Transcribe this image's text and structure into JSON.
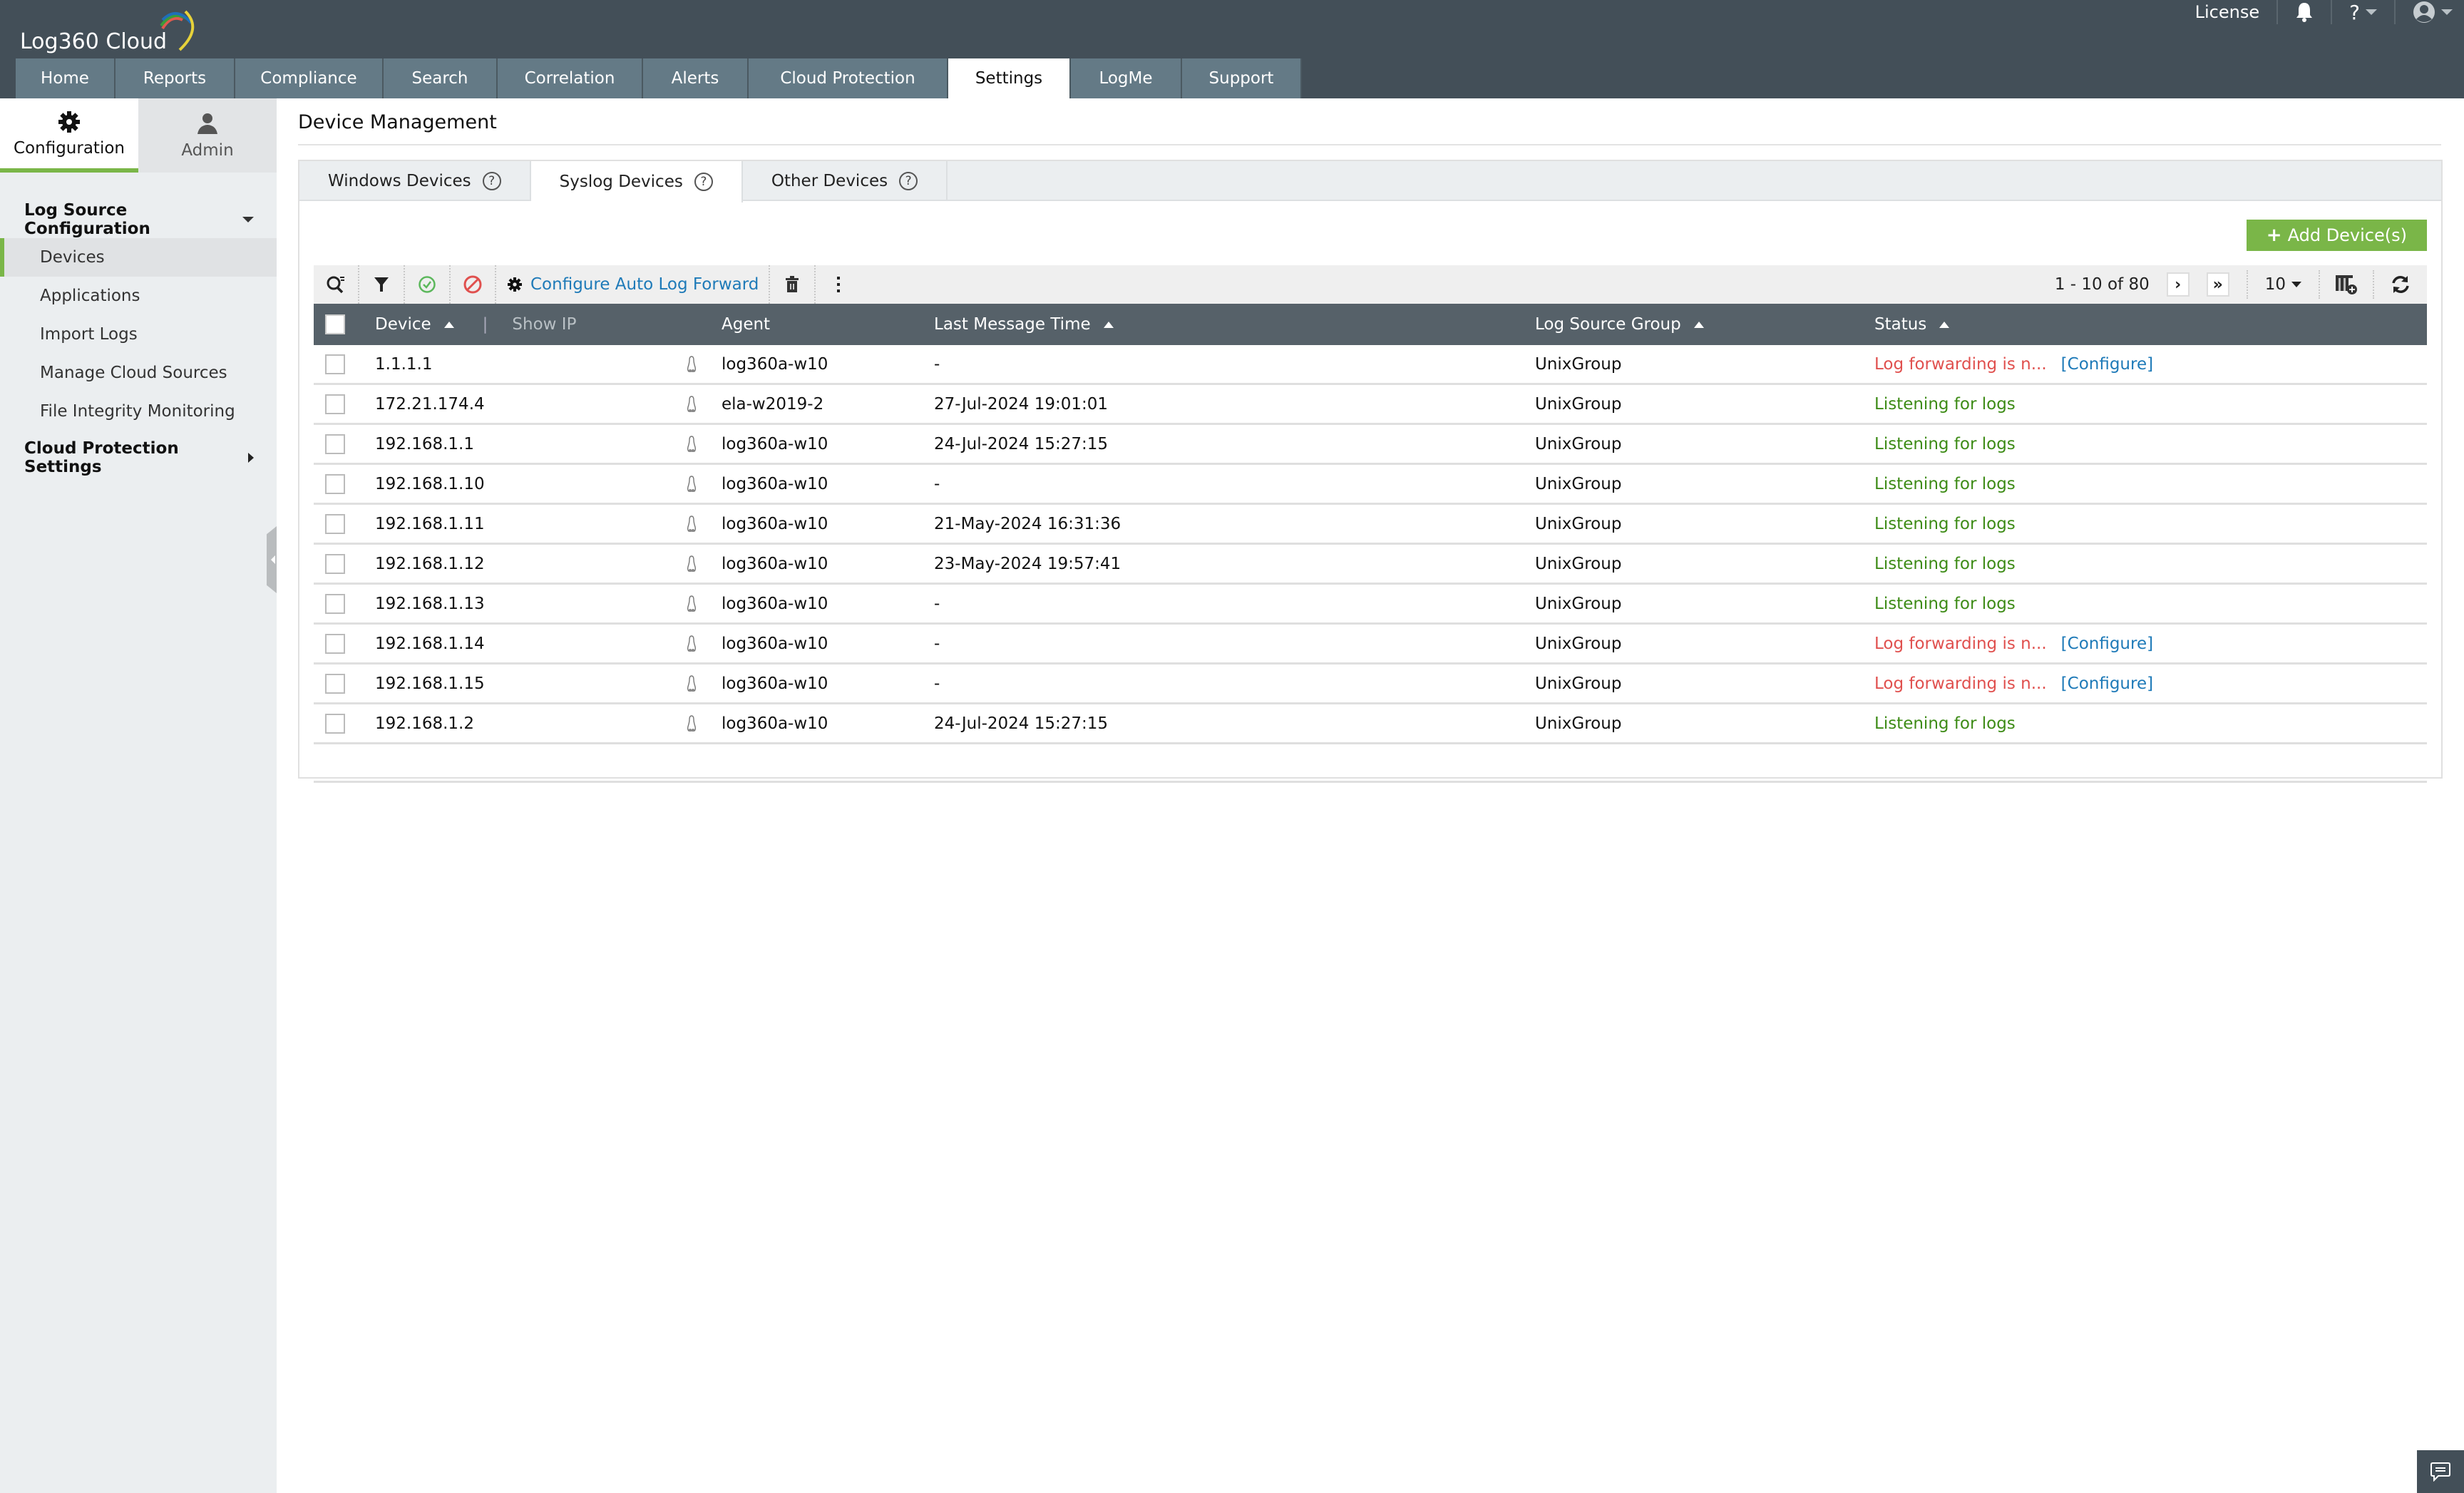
{
  "app": {
    "logo_text": "Log360 Cloud",
    "brand_accent": "#7ab648"
  },
  "header": {
    "license_label": "License",
    "help_label": "?",
    "icons": [
      "bell-icon",
      "help-icon",
      "user-avatar-icon"
    ]
  },
  "nav": {
    "tabs": [
      {
        "label": "Home"
      },
      {
        "label": "Reports"
      },
      {
        "label": "Compliance"
      },
      {
        "label": "Search"
      },
      {
        "label": "Correlation"
      },
      {
        "label": "Alerts"
      },
      {
        "label": "Cloud Protection"
      },
      {
        "label": "Settings",
        "active": true
      },
      {
        "label": "LogMe"
      },
      {
        "label": "Support"
      }
    ]
  },
  "sidebar": {
    "switch": [
      {
        "label": "Configuration",
        "icon": "gear-icon",
        "active": true
      },
      {
        "label": "Admin",
        "icon": "admin-user-icon"
      }
    ],
    "group1": {
      "label": "Log Source Configuration",
      "expanded": true,
      "items": [
        {
          "label": "Devices",
          "active": true
        },
        {
          "label": "Applications"
        },
        {
          "label": "Import Logs"
        },
        {
          "label": "Manage Cloud Sources"
        },
        {
          "label": "File Integrity Monitoring"
        }
      ]
    },
    "group2": {
      "label": "Cloud Protection Settings",
      "expanded": false
    }
  },
  "main": {
    "title": "Device Management",
    "tabs": [
      {
        "label": "Windows Devices"
      },
      {
        "label": "Syslog Devices",
        "active": true
      },
      {
        "label": "Other Devices"
      }
    ],
    "add_button": "Add Device(s)",
    "toolbar": {
      "configure_link": "Configure Auto Log Forward",
      "pagination_text": "1 - 10 of 80",
      "page_size": "10"
    },
    "table": {
      "headers": {
        "device": "Device",
        "show_ip": "Show IP",
        "agent": "Agent",
        "last_message_time": "Last Message Time",
        "log_source_group": "Log Source Group",
        "status": "Status"
      },
      "configure_label": "[Configure]",
      "rows": [
        {
          "device": "1.1.1.1",
          "agent": "log360a-w10",
          "time": "-",
          "group": "UnixGroup",
          "status": "Log forwarding is n...",
          "status_type": "error",
          "configure": true
        },
        {
          "device": "172.21.174.4",
          "agent": "ela-w2019-2",
          "time": "27-Jul-2024 19:01:01",
          "group": "UnixGroup",
          "status": "Listening for logs",
          "status_type": "ok",
          "configure": false
        },
        {
          "device": "192.168.1.1",
          "agent": "log360a-w10",
          "time": "24-Jul-2024 15:27:15",
          "group": "UnixGroup",
          "status": "Listening for logs",
          "status_type": "ok",
          "configure": false
        },
        {
          "device": "192.168.1.10",
          "agent": "log360a-w10",
          "time": "-",
          "group": "UnixGroup",
          "status": "Listening for logs",
          "status_type": "ok",
          "configure": false
        },
        {
          "device": "192.168.1.11",
          "agent": "log360a-w10",
          "time": "21-May-2024 16:31:36",
          "group": "UnixGroup",
          "status": "Listening for logs",
          "status_type": "ok",
          "configure": false
        },
        {
          "device": "192.168.1.12",
          "agent": "log360a-w10",
          "time": "23-May-2024 19:57:41",
          "group": "UnixGroup",
          "status": "Listening for logs",
          "status_type": "ok",
          "configure": false
        },
        {
          "device": "192.168.1.13",
          "agent": "log360a-w10",
          "time": "-",
          "group": "UnixGroup",
          "status": "Listening for logs",
          "status_type": "ok",
          "configure": false
        },
        {
          "device": "192.168.1.14",
          "agent": "log360a-w10",
          "time": "-",
          "group": "UnixGroup",
          "status": "Log forwarding is n...",
          "status_type": "error",
          "configure": true
        },
        {
          "device": "192.168.1.15",
          "agent": "log360a-w10",
          "time": "-",
          "group": "UnixGroup",
          "status": "Log forwarding is n...",
          "status_type": "error",
          "configure": true
        },
        {
          "device": "192.168.1.2",
          "agent": "log360a-w10",
          "time": "24-Jul-2024 15:27:15",
          "group": "UnixGroup",
          "status": "Listening for logs",
          "status_type": "ok",
          "configure": false
        }
      ]
    }
  },
  "colors": {
    "status_error": "#e0504e",
    "status_ok": "#3d8b16",
    "link": "#1e7ab8",
    "header_bg": "#434f58",
    "nav_tab_bg": "#647a86",
    "table_header_bg": "#566169"
  }
}
